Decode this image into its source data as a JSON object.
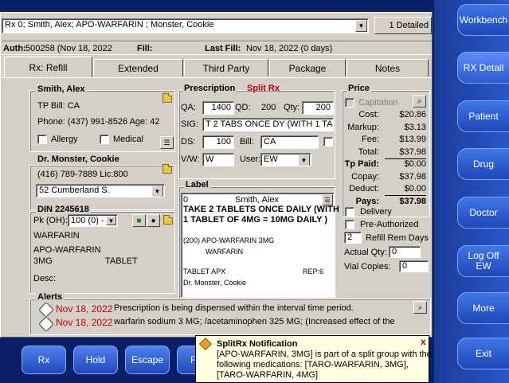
{
  "nav": {
    "workbench": "Workbench",
    "rx_detail": "RX Detail",
    "patient": "Patient",
    "drug": "Drug",
    "doctor": "Doctor",
    "logoff_line1": "Log Off",
    "logoff_line2": "EW",
    "more": "More",
    "exit": "Exit"
  },
  "rx_selector": {
    "value": "Rx 0; Smith, Alex; APO-WARFARIN ; Monster, Cookie",
    "detail_count": "1 Detailed"
  },
  "auth_bar": {
    "auth_label": "Auth:",
    "auth_value": "500258 (Nov 18, 2022",
    "fill_label": "Fill:",
    "last_fill_label": "Last Fill:",
    "last_fill_value": "Nov 18, 2022 (0 days)"
  },
  "tabs": [
    "Rx: Refill",
    "Extended",
    "Third Party",
    "Package",
    "Notes"
  ],
  "patient": {
    "name": "Smith, Alex",
    "tp_bill": "TP Bill: CA",
    "phone": "Phone: (437) 991-8526 Age: 42",
    "allergy_label": "Allergy",
    "medical_label": "Medical"
  },
  "doctor": {
    "name": "Dr. Monster, Cookie",
    "phone_lic": "(416) 789-7889 Lic:800",
    "address": "52 Cumberland S."
  },
  "din": {
    "title": "DIN 2245618",
    "pk_label": "Pk (OH):",
    "pk_value": "100 (0) -",
    "line1": "WARFARIN",
    "line2": "APO-WARFARIN",
    "strength": "3MG",
    "form": "TABLET",
    "desc_label": "Desc:"
  },
  "prescription": {
    "title": "Prescription",
    "split_label": "Split Rx",
    "qa_label": "QA:",
    "qa_value": "1400",
    "qd_label": "QD:",
    "qd_value": "200",
    "qty_label": "Qty:",
    "qty_value": "200",
    "sig_label": "SIG:",
    "sig_value": "T 2 TABS ONCE DY (WITH 1 TAB",
    "ds_label": "DS:",
    "ds_value": "100",
    "bill_label": "Bill:",
    "bill_value": "CA",
    "vw_label": "V/W:",
    "vw_value": "W",
    "user_label": "User:",
    "user_value": "EW"
  },
  "label": {
    "title": "Label",
    "num": "0",
    "patient": "Smith, Alex",
    "instr1": "TAKE 2 TABLETS ONCE DAILY (WITH",
    "instr2": "1 TABLET OF 4MG = 10MG DAILY )",
    "qty_drug": "(200)  APO-WARFARIN 3MG",
    "drug2": "WARFARIN",
    "form": "TABLET APX",
    "rep": "REP:6",
    "doctor": "Dr. Monster, Cookie"
  },
  "price": {
    "title": "Price",
    "capitation_label": "Capitation",
    "rows": [
      {
        "label": "Cost:",
        "value": "$20.86"
      },
      {
        "label": "Markup:",
        "value": "$3.13"
      },
      {
        "label": "Fee:",
        "value": "$13.99"
      },
      {
        "label": "Total:",
        "value": "$37.98"
      },
      {
        "label": "Tp Paid:",
        "value": "$0.00"
      },
      {
        "label": "Copay:",
        "value": "$37.98"
      },
      {
        "label": "Deduct:",
        "value": "$0.00"
      },
      {
        "label": "Pays:",
        "value": "$37.98"
      }
    ],
    "delivery_label": "Delivery",
    "preauth_label": "Pre-Authorized",
    "refill_rem_value": "2",
    "refill_rem_label": "Refill Rem Days",
    "actual_qty_label": "Actual Qty:",
    "actual_qty_value": "0",
    "vial_label": "Vial Copies:",
    "vial_value": "0"
  },
  "alerts": {
    "title": "Alerts",
    "items": [
      {
        "date": "Nov 18, 2022",
        "text": "Prescription is being dispensed within the interval time period."
      },
      {
        "date": "Nov 18, 2022",
        "text": "warfarin sodium 3 MG; /acetaminophen 325 MG; (Increased effect of the"
      }
    ]
  },
  "bottom_buttons": [
    "Rx",
    "Hold",
    "Escape",
    "F"
  ],
  "notification": {
    "title": "SplitRx Notification",
    "line1": "[APO-WARFARIN, 3MG] is part of a split group with the",
    "line2": "following medications: [TARO-WARFARIN, 3MG],",
    "line3": "[TARO-WARFARIN, 4MG]",
    "close": "x"
  },
  "colors": {
    "accent_red": "#c00000",
    "nav_blue": "#2e5ad0",
    "background": "#0b1f66"
  }
}
